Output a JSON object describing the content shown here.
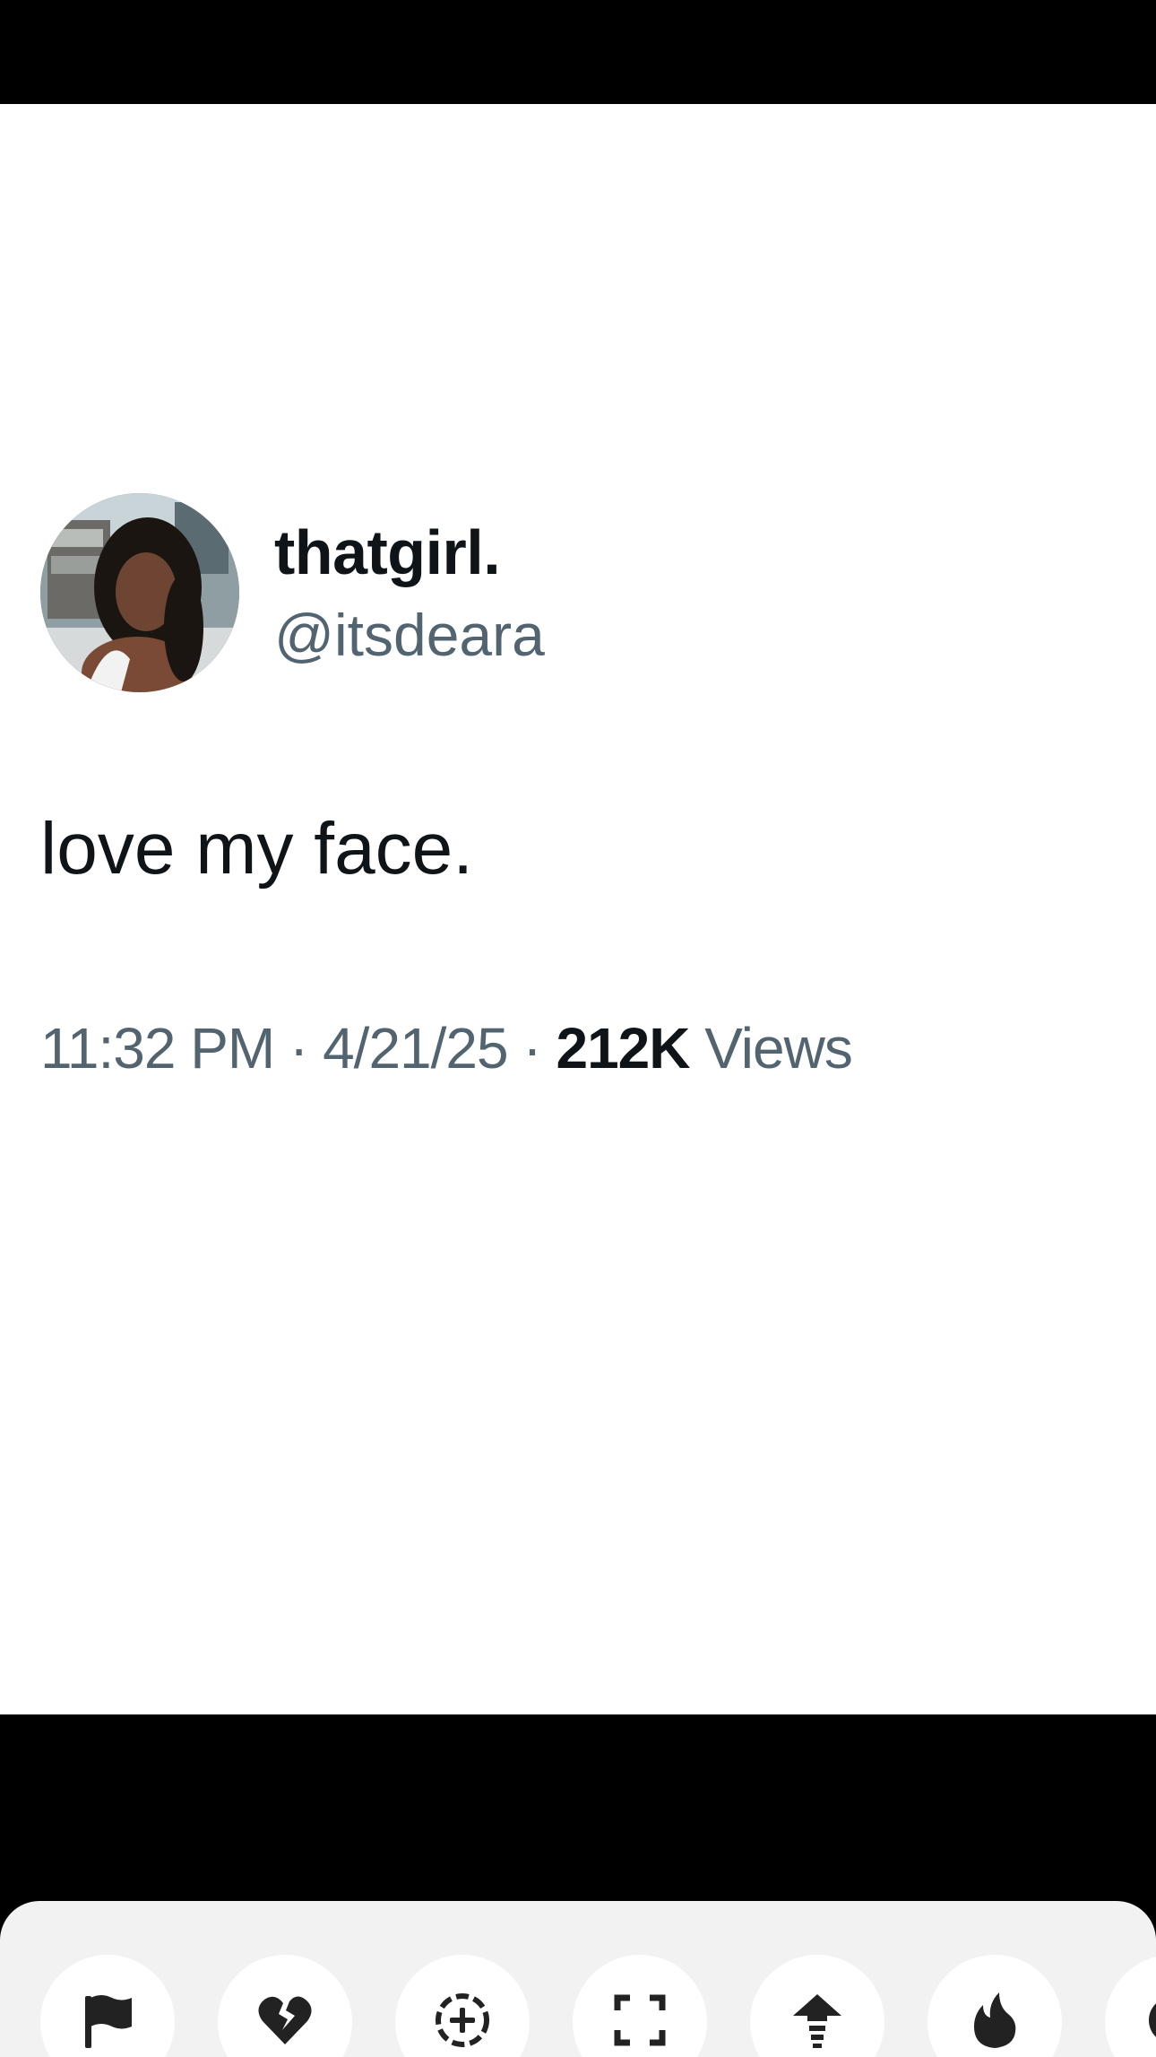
{
  "tweet": {
    "display_name": "thatgirl.",
    "handle": "@itsdeara",
    "text": "love my face.",
    "time": "11:32 PM",
    "separator": "·",
    "date": "4/21/25",
    "views_count": "212K",
    "views_label": "Views"
  },
  "action_bar": {
    "buttons": [
      {
        "icon": "flag-icon",
        "name": "report-button"
      },
      {
        "icon": "broken-heart-icon",
        "name": "not-interested-button"
      },
      {
        "icon": "add-circle-icon",
        "name": "add-button"
      },
      {
        "icon": "fullscreen-icon",
        "name": "fullscreen-button"
      },
      {
        "icon": "upload-arrow-icon",
        "name": "share-up-button"
      },
      {
        "icon": "fire-icon",
        "name": "fire-button"
      }
    ]
  },
  "colors": {
    "text_primary": "#0f1419",
    "text_secondary": "#536471",
    "sheet_background": "#f2f2f2",
    "icon_color": "#222222"
  }
}
